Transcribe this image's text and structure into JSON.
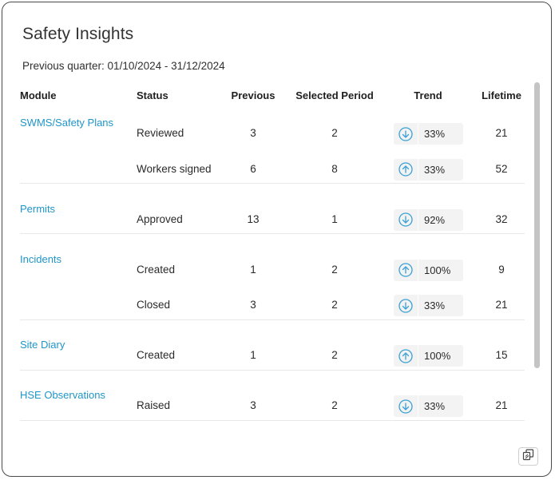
{
  "panel": {
    "title": "Safety Insights",
    "subtitle": "Previous quarter: 01/10/2024 - 31/12/2024"
  },
  "table": {
    "headers": {
      "module": "Module",
      "status": "Status",
      "previous": "Previous",
      "selected": "Selected Period",
      "trend": "Trend",
      "lifetime": "Lifetime"
    },
    "groups": [
      {
        "module": "SWMS/Safety Plans",
        "rows": [
          {
            "status": "Reviewed",
            "previous": "3",
            "selected": "2",
            "trend_dir": "down",
            "trend_pct": "33%",
            "lifetime": "21"
          },
          {
            "status": "Workers signed",
            "previous": "6",
            "selected": "8",
            "trend_dir": "up",
            "trend_pct": "33%",
            "lifetime": "52"
          }
        ]
      },
      {
        "module": "Permits",
        "rows": [
          {
            "status": "Approved",
            "previous": "13",
            "selected": "1",
            "trend_dir": "down",
            "trend_pct": "92%",
            "lifetime": "32"
          }
        ]
      },
      {
        "module": "Incidents",
        "rows": [
          {
            "status": "Created",
            "previous": "1",
            "selected": "2",
            "trend_dir": "up",
            "trend_pct": "100%",
            "lifetime": "9"
          },
          {
            "status": "Closed",
            "previous": "3",
            "selected": "2",
            "trend_dir": "down",
            "trend_pct": "33%",
            "lifetime": "21"
          }
        ]
      },
      {
        "module": "Site Diary",
        "rows": [
          {
            "status": "Created",
            "previous": "1",
            "selected": "2",
            "trend_dir": "up",
            "trend_pct": "100%",
            "lifetime": "15"
          }
        ]
      },
      {
        "module": "HSE Observations",
        "rows": [
          {
            "status": "Raised",
            "previous": "3",
            "selected": "2",
            "trend_dir": "down",
            "trend_pct": "33%",
            "lifetime": "21"
          }
        ]
      }
    ]
  },
  "colors": {
    "link": "#1f95c9",
    "trend_icon": "#3aa0d6",
    "trend_bg": "#f3f3f3"
  },
  "icons": {
    "trend_up": "arrow-up-circle-icon",
    "trend_down": "arrow-down-circle-icon",
    "footer_button": "copy-icon"
  }
}
